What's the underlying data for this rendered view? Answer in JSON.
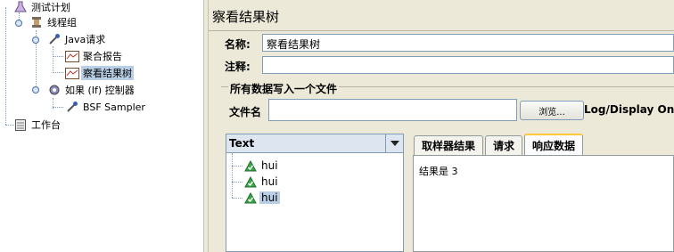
{
  "tree": {
    "items": [
      {
        "label": "测试计划",
        "icon": "flask-icon"
      },
      {
        "label": "线程组",
        "icon": "spool-icon"
      },
      {
        "label": "Java请求",
        "icon": "pipette-icon"
      },
      {
        "label": "聚合报告",
        "icon": "chart-icon"
      },
      {
        "label": "察看结果树",
        "icon": "chart-icon"
      },
      {
        "label": "如果 (If) 控制器",
        "icon": "gear-icon"
      },
      {
        "label": "BSF Sampler",
        "icon": "pipette-icon"
      },
      {
        "label": "工作台",
        "icon": "notepad-icon"
      }
    ]
  },
  "panel": {
    "title": "察看结果树",
    "name_label": "名称:",
    "name_value": "察看结果树",
    "comment_label": "注释:",
    "comment_value": "",
    "group_title": "所有数据写入一个文件",
    "file_label": "文件名",
    "file_value": "",
    "browse_label": "浏览...",
    "log_label": "Log/Display Only:"
  },
  "results": {
    "renderer": "Text",
    "items": [
      "hui",
      "hui",
      "hui"
    ],
    "selected_index": 2
  },
  "tabs": {
    "items": [
      "取样器结果",
      "请求",
      "响应数据"
    ],
    "active_index": 2
  },
  "response": {
    "text": "结果是 3"
  },
  "colors": {
    "panel_bg": "#ece9d8",
    "selection": "#b8cfe5",
    "tab_active_accent": "#ffc83c",
    "success_green": "#3aa84a"
  }
}
